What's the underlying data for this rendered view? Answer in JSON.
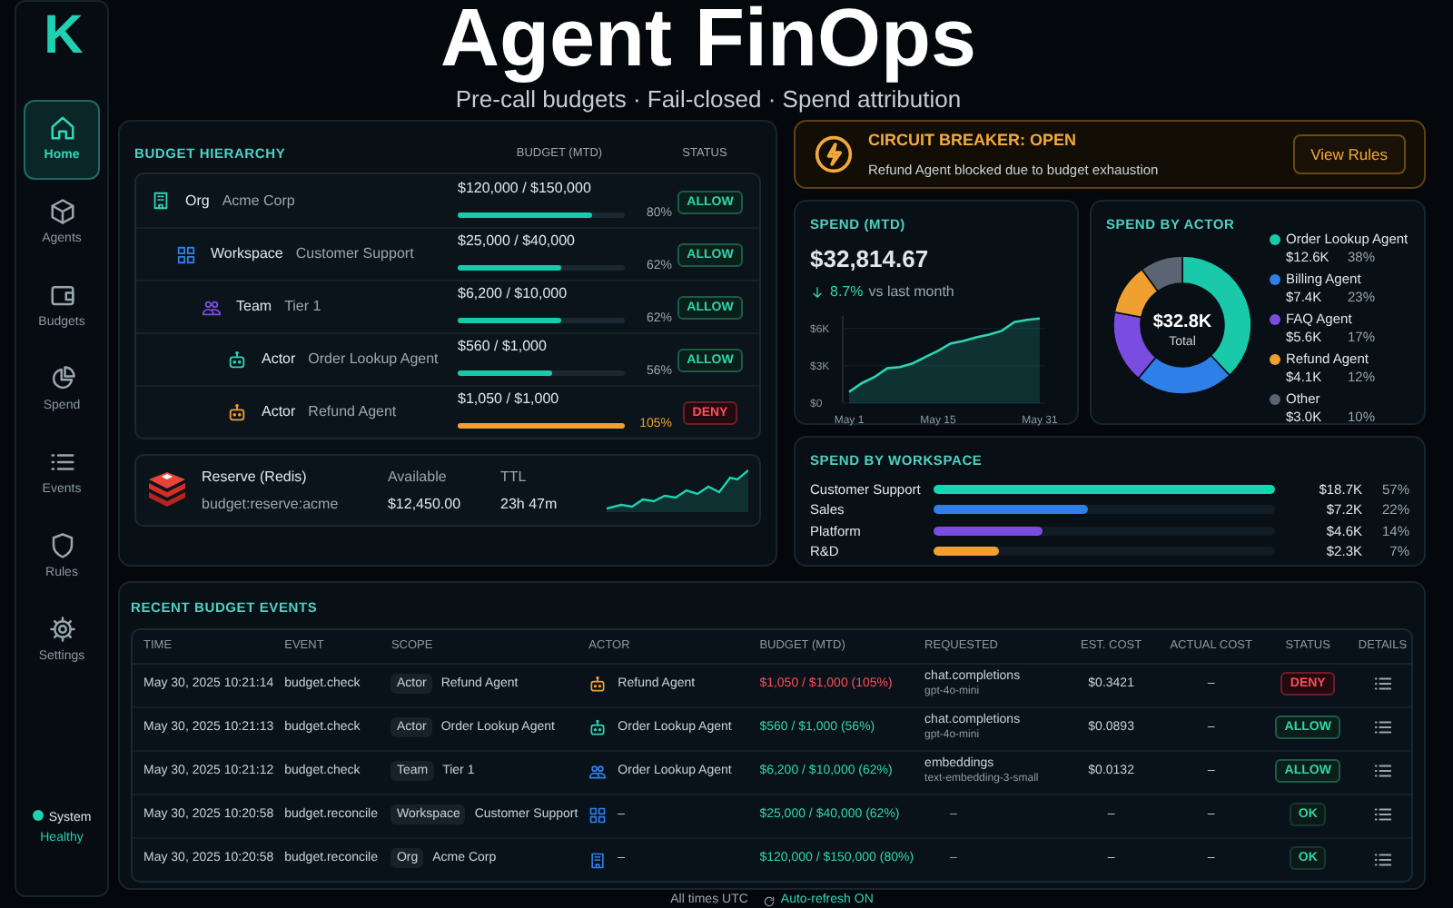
{
  "sidebar": {
    "logo": "K",
    "items": [
      {
        "label": "Home",
        "selected": true
      },
      {
        "label": "Agents",
        "selected": false
      },
      {
        "label": "Budgets",
        "selected": false
      },
      {
        "label": "Spend",
        "selected": false
      },
      {
        "label": "Events",
        "selected": false
      },
      {
        "label": "Rules",
        "selected": false
      },
      {
        "label": "Settings",
        "selected": false
      }
    ],
    "system": {
      "label": "System",
      "status": "Healthy",
      "healthy": true
    }
  },
  "header": {
    "title": "Agent FinOps",
    "subtitle": "Pre-call budgets · Fail-closed · Spend attribution"
  },
  "hierarchy": {
    "title": "BUDGET HIERARCHY",
    "columns": [
      "BUDGET (MTD)",
      "STATUS"
    ],
    "nodes": [
      {
        "kind": "org",
        "type": "Org",
        "name": "Acme Corp",
        "budget": "$120,000 / $150,000",
        "percent": "80%",
        "level": 0.8,
        "over_budget": false,
        "status": {
          "label": "ALLOW",
          "kind": "allow"
        },
        "children": [
          {
            "kind": "workspace",
            "type": "Workspace",
            "name": "Customer Support",
            "budget": "$25,000 / $40,000",
            "percent": "62%",
            "level": 0.62,
            "over_budget": false,
            "status": {
              "label": "ALLOW",
              "kind": "allow"
            },
            "children": [
              {
                "kind": "team",
                "type": "Team",
                "name": "Tier 1",
                "budget": "$6,200 / $10,000",
                "percent": "62%",
                "level": 0.62,
                "over_budget": false,
                "status": {
                  "label": "ALLOW",
                  "kind": "allow"
                },
                "children": [
                  {
                    "kind": "actor",
                    "type": "Actor",
                    "name": "Order Lookup Agent",
                    "budget": "$560 / $1,000",
                    "percent": "56%",
                    "level": 0.56,
                    "over_budget": false,
                    "status": {
                      "label": "ALLOW",
                      "kind": "allow"
                    }
                  },
                  {
                    "kind": "actor",
                    "type": "Actor",
                    "name": "Refund Agent",
                    "budget": "$1,050 / $1,000",
                    "percent": "105%",
                    "level": 1.0,
                    "over_budget": true,
                    "status": {
                      "label": "DENY",
                      "kind": "deny"
                    }
                  }
                ]
              }
            ]
          }
        ]
      }
    ]
  },
  "reserve": {
    "title": "Reserve (Redis)",
    "key": "budget:reserve:acme",
    "available_label": "Available",
    "available": "$12,450.00",
    "ttl_label": "TTL",
    "ttl": "23h 47m"
  },
  "circuit_breaker": {
    "title": "CIRCUIT BREAKER: OPEN",
    "message": "Refund Agent blocked due to budget exhaustion",
    "button": "View Rules"
  },
  "spend_mtd": {
    "title": "SPEND (MTD)",
    "amount": "$32,814.67",
    "change": "8.7%",
    "change_label": "vs last month",
    "chart_data": {
      "type": "area",
      "categories": [
        "May 1",
        null,
        null,
        null,
        null,
        null,
        null,
        "May 15",
        null,
        null,
        null,
        null,
        null,
        null,
        null,
        "May 31"
      ],
      "series": [
        {
          "color": "#2dd4b4",
          "values": [
            900,
            1600,
            2100,
            2800,
            2900,
            3200,
            3700,
            4200,
            4800,
            5000,
            5300,
            5500,
            5800,
            6500,
            6700,
            6800
          ]
        }
      ],
      "ylim": [
        0,
        7000
      ],
      "yticks": [
        {
          "value": 0,
          "label": "$0"
        },
        {
          "value": 3000,
          "label": "$3K"
        },
        {
          "value": 6000,
          "label": "$6K"
        }
      ]
    }
  },
  "spend_by_actor": {
    "title": "SPEND BY ACTOR",
    "total": "$32.8K",
    "total_label": "Total",
    "chart_data": {
      "type": "donut",
      "categories": [
        "Order Lookup Agent",
        "Billing Agent",
        "FAQ Agent",
        "Refund Agent",
        "Other"
      ],
      "series": [
        {
          "values": [
            38,
            23,
            17,
            12,
            10
          ]
        }
      ]
    },
    "legend": [
      {
        "amount": "$12.6K",
        "percent": "38%",
        "color": "#19c9a9"
      },
      {
        "amount": "$7.4K",
        "percent": "23%",
        "color": "#2f7fe8"
      },
      {
        "amount": "$5.6K",
        "percent": "17%",
        "color": "#7b4ce0"
      },
      {
        "amount": "$4.1K",
        "percent": "12%",
        "color": "#f0a030"
      },
      {
        "amount": "$3.0K",
        "percent": "10%",
        "color": "#5a6473"
      }
    ]
  },
  "spend_by_workspace": {
    "title": "SPEND BY WORKSPACE",
    "items": [
      {
        "name": "Customer Support",
        "amount": "$18.7K",
        "percent": "57%",
        "level": 1.0,
        "color": "#19d4b0"
      },
      {
        "name": "Sales",
        "amount": "$7.2K",
        "percent": "22%",
        "level": 0.45,
        "color": "#2f7fe8"
      },
      {
        "name": "Platform",
        "amount": "$4.6K",
        "percent": "14%",
        "level": 0.32,
        "color": "#7b4ce0"
      },
      {
        "name": "R&D",
        "amount": "$2.3K",
        "percent": "7%",
        "level": 0.19,
        "color": "#f0a030"
      }
    ]
  },
  "events": {
    "title": "RECENT BUDGET EVENTS",
    "columns": [
      "TIME",
      "EVENT",
      "SCOPE",
      "ACTOR",
      "BUDGET (MTD)",
      "REQUESTED",
      "EST. COST",
      "ACTUAL COST",
      "STATUS",
      "DETAILS"
    ],
    "rows": [
      {
        "time": "May 30, 2025 10:21:14",
        "event": "budget.check",
        "scope_type": "Actor",
        "scope_name": "Refund Agent",
        "actor": {
          "kind": "actor",
          "name": "Refund Agent",
          "over_budget": true
        },
        "budget": "$1,050 / $1,000 (105%)",
        "over_budget": true,
        "requested": "chat.completions",
        "model": "gpt-4o-mini",
        "est_cost": "$0.3421",
        "actual_cost": "–",
        "status": {
          "label": "DENY",
          "kind": "deny"
        }
      },
      {
        "time": "May 30, 2025 10:21:13",
        "event": "budget.check",
        "scope_type": "Actor",
        "scope_name": "Order Lookup Agent",
        "actor": {
          "kind": "actor",
          "name": "Order Lookup Agent",
          "over_budget": false
        },
        "budget": "$560 / $1,000 (56%)",
        "over_budget": false,
        "requested": "chat.completions",
        "model": "gpt-4o-mini",
        "est_cost": "$0.0893",
        "actual_cost": "–",
        "status": {
          "label": "ALLOW",
          "kind": "allow"
        }
      },
      {
        "time": "May 30, 2025 10:21:12",
        "event": "budget.check",
        "scope_type": "Team",
        "scope_name": "Tier 1",
        "actor": {
          "kind": "team",
          "name": "Order Lookup Agent",
          "over_budget": false
        },
        "budget": "$6,200 / $10,000 (62%)",
        "over_budget": false,
        "requested": "embeddings",
        "model": "text-embedding-3-small",
        "est_cost": "$0.0132",
        "actual_cost": "–",
        "status": {
          "label": "ALLOW",
          "kind": "allow"
        }
      },
      {
        "time": "May 30, 2025 10:20:58",
        "event": "budget.reconcile",
        "scope_type": "Workspace",
        "scope_name": "Customer Support",
        "actor": {
          "kind": "workspace",
          "name": "–",
          "over_budget": false
        },
        "budget": "$25,000 / $40,000 (62%)",
        "over_budget": false,
        "requested": "–",
        "est_cost": "–",
        "actual_cost": "–",
        "status": {
          "label": "OK",
          "kind": "ok"
        }
      },
      {
        "time": "May 30, 2025 10:20:58",
        "event": "budget.reconcile",
        "scope_type": "Org",
        "scope_name": "Acme Corp",
        "actor": {
          "kind": "org",
          "name": "–",
          "over_budget": false
        },
        "budget": "$120,000 / $150,000 (80%)",
        "over_budget": false,
        "requested": "–",
        "est_cost": "–",
        "actual_cost": "–",
        "status": {
          "label": "OK",
          "kind": "ok"
        }
      }
    ]
  },
  "footer": {
    "timezone": "All times UTC",
    "refresh": "Auto-refresh ON"
  }
}
